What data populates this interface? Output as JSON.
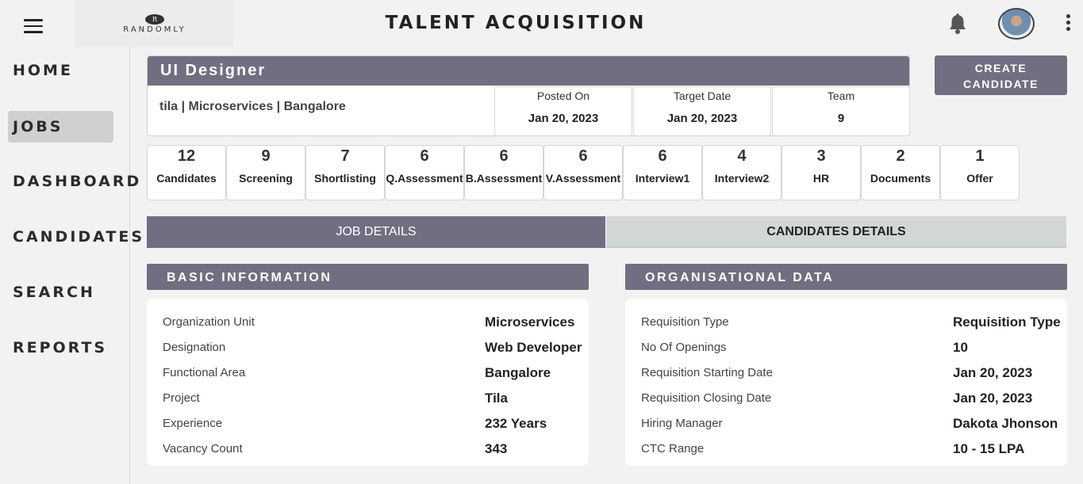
{
  "header": {
    "logo_mark": "R",
    "logo_text": "RANDOMLY",
    "title": "TALENT ACQUISITION"
  },
  "sidebar": {
    "items": [
      {
        "label": "HOME",
        "active": false
      },
      {
        "label": "JOBS",
        "active": true
      },
      {
        "label": "DASHBOARD",
        "active": false
      },
      {
        "label": "CANDIDATES",
        "active": false
      },
      {
        "label": "SEARCH",
        "active": false
      },
      {
        "label": "REPORTS",
        "active": false
      }
    ]
  },
  "job": {
    "title": "UI Designer",
    "subtitle": "tila | Microservices | Bangalore",
    "posted_on_label": "Posted On",
    "posted_on": "Jan 20, 2023",
    "target_date_label": "Target Date",
    "target_date": "Jan 20, 2023",
    "team_label": "Team",
    "team": "9"
  },
  "create_button": {
    "line1": "CREATE",
    "line2": "CANDIDATE"
  },
  "stages": [
    {
      "count": "12",
      "label": "Candidates"
    },
    {
      "count": "9",
      "label": "Screening"
    },
    {
      "count": "7",
      "label": "Shortlisting"
    },
    {
      "count": "6",
      "label": "Q.Assessment"
    },
    {
      "count": "6",
      "label": "B.Assessment"
    },
    {
      "count": "6",
      "label": "V.Assessment"
    },
    {
      "count": "6",
      "label": "Interview1"
    },
    {
      "count": "4",
      "label": "Interview2"
    },
    {
      "count": "3",
      "label": "HR"
    },
    {
      "count": "2",
      "label": "Documents"
    },
    {
      "count": "1",
      "label": "Offer"
    }
  ],
  "tabs": {
    "job_details": "JOB DETAILS",
    "candidates_details": "CANDIDATES DETAILS",
    "active": "job_details"
  },
  "basic_info": {
    "title": "BASIC INFORMATION",
    "rows": [
      {
        "label": "Organization Unit",
        "value": "Microservices"
      },
      {
        "label": "Designation",
        "value": "Web Developer"
      },
      {
        "label": "Functional Area",
        "value": "Bangalore"
      },
      {
        "label": "Project",
        "value": "Tila"
      },
      {
        "label": "Experience",
        "value": "232 Years"
      },
      {
        "label": "Vacancy Count",
        "value": "343"
      }
    ]
  },
  "org_data": {
    "title": "ORGANISATIONAL DATA",
    "rows": [
      {
        "label": "Requisition Type",
        "value": "Requisition Type"
      },
      {
        "label": "No Of Openings",
        "value": "10"
      },
      {
        "label": "Requisition Starting Date",
        "value": "Jan 20, 2023"
      },
      {
        "label": "Requisition Closing Date",
        "value": "Jan 20, 2023"
      },
      {
        "label": "Hiring Manager",
        "value": "Dakota Jhonson"
      },
      {
        "label": "CTC Range",
        "value": "10 - 15 LPA"
      }
    ]
  },
  "colors": {
    "accent": "#726e82",
    "tab_inactive": "#d2d7d6",
    "background": "#f2f2f2"
  },
  "icons": {
    "menu": "hamburger-menu-icon",
    "notifications": "bell-icon",
    "profile": "avatar",
    "more": "kebab-menu-icon"
  }
}
